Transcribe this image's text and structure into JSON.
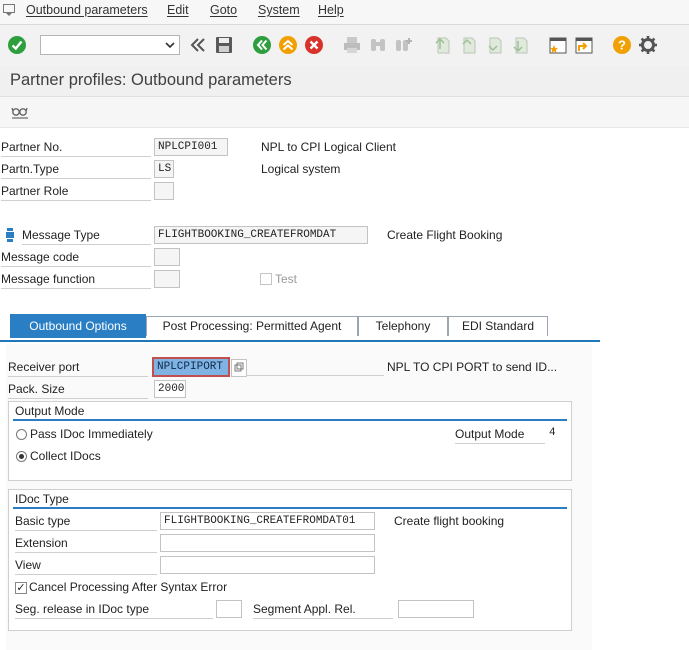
{
  "menubar": {
    "items": [
      "Outbound parameters",
      "Edit",
      "Goto",
      "System",
      "Help"
    ]
  },
  "toolbar": {
    "command_value": "",
    "icons": [
      "enter-check-icon",
      "back-chevrons-icon",
      "save-icon",
      "back-icon",
      "exit-icon",
      "cancel-icon",
      "print-icon",
      "find-icon",
      "find-next-icon",
      "first-page-icon",
      "previous-page-icon",
      "next-page-icon",
      "last-page-icon",
      "new-session-icon",
      "shortcut-icon",
      "help-icon",
      "settings-gear-icon"
    ]
  },
  "title": "Partner profiles: Outbound parameters",
  "header": {
    "partner_no_label": "Partner No.",
    "partner_no_value": "NPLCPI001",
    "partner_no_desc": "NPL to CPI Logical Client",
    "partn_type_label": "Partn.Type",
    "partn_type_value": "LS",
    "partn_type_desc": "Logical system",
    "partner_role_label": "Partner Role",
    "partner_role_value": "",
    "message_type_label": "Message Type",
    "message_type_value": "FLIGHTBOOKING_CREATEFROMDAT",
    "message_type_desc": "Create Flight Booking",
    "message_code_label": "Message code",
    "message_code_value": "",
    "message_function_label": "Message function",
    "message_function_value": "",
    "test_label": "Test",
    "test_checked": false
  },
  "tabs": [
    "Outbound Options",
    "Post Processing: Permitted Agent",
    "Telephony",
    "EDI Standard"
  ],
  "outbound": {
    "receiver_port_label": "Receiver port",
    "receiver_port_value": "NPLCPIPORT",
    "receiver_port_desc": "NPL TO CPI PORT to send ID...",
    "pack_size_label": "Pack. Size",
    "pack_size_value": "2000",
    "output_mode_title": "Output Mode",
    "pass_idoc_label": "Pass IDoc Immediately",
    "collect_idocs_label": "Collect IDocs",
    "selected_mode": "Collect IDocs",
    "output_mode_label": "Output Mode",
    "output_mode_value": "4",
    "idoc_type_title": "IDoc Type",
    "basic_type_label": "Basic type",
    "basic_type_value": "FLIGHTBOOKING_CREATEFROMDAT01",
    "basic_type_desc": "Create flight booking",
    "extension_label": "Extension",
    "extension_value": "",
    "view_label": "View",
    "view_value": "",
    "cancel_processing_label": "Cancel Processing After Syntax Error",
    "cancel_processing_checked": true,
    "seg_release_label": "Seg. release in IDoc type",
    "seg_release_value": "",
    "segment_appl_rel_label": "Segment Appl. Rel.",
    "segment_appl_rel_value": ""
  },
  "colors": {
    "accent_blue": "#2a7fc4",
    "ok_green": "#2e9e3e",
    "cancel_red": "#d9322b",
    "up_orange": "#f2a000",
    "help_orange": "#f0a000"
  }
}
